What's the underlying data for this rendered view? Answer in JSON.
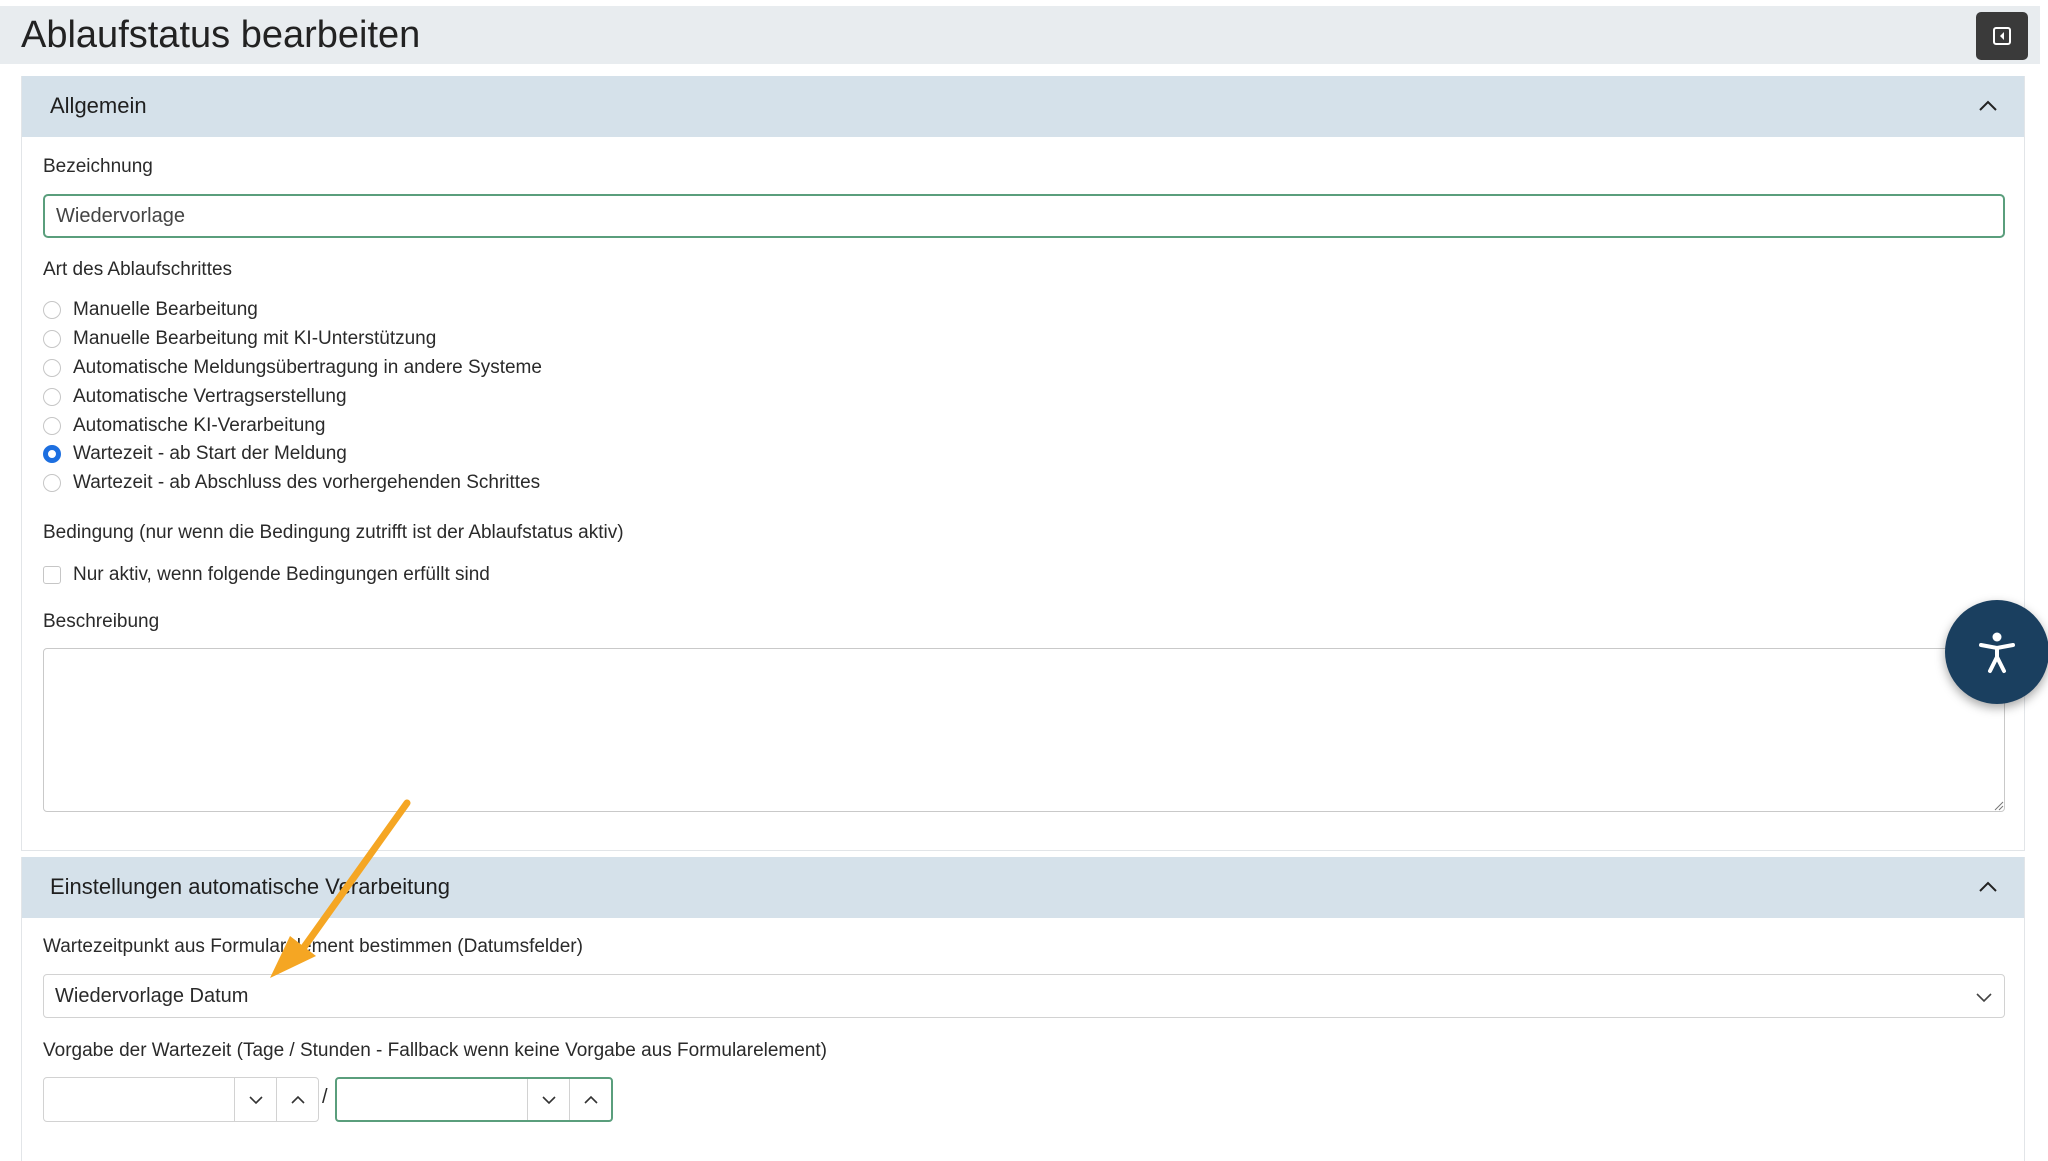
{
  "page": {
    "title": "Ablaufstatus bearbeiten"
  },
  "general": {
    "header": "Allgemein",
    "name_label": "Bezeichnung",
    "name_value": "Wiedervorlage",
    "type_label": "Art des Ablaufschrittes",
    "options": [
      {
        "label": "Manuelle Bearbeitung",
        "checked": false
      },
      {
        "label": "Manuelle Bearbeitung mit KI-Unterstützung",
        "checked": false
      },
      {
        "label": "Automatische Meldungsübertragung in andere Systeme",
        "checked": false
      },
      {
        "label": "Automatische Vertragserstellung",
        "checked": false
      },
      {
        "label": "Automatische KI-Verarbeitung",
        "checked": false
      },
      {
        "label": "Wartezeit - ab Start der Meldung",
        "checked": true
      },
      {
        "label": "Wartezeit - ab Abschluss des vorhergehenden Schrittes",
        "checked": false
      }
    ],
    "condition_label": "Bedingung (nur wenn die Bedingung zutrifft ist der Ablaufstatus aktiv)",
    "condition_checkbox_label": "Nur aktiv, wenn folgende Bedingungen erfüllt sind",
    "description_label": "Beschreibung",
    "description_value": ""
  },
  "auto": {
    "header": "Einstellungen automatische Verarbeitung",
    "wait_point_label": "Wartezeitpunkt aus Formularelement bestimmen (Datumsfelder)",
    "wait_point_value": "Wiedervorlage Datum",
    "default_wait_label": "Vorgabe der Wartezeit (Tage / Stunden - Fallback wenn keine Vorgabe aus Formularelement)",
    "days_value": "",
    "hours_value": "",
    "separator": "/"
  },
  "colors": {
    "section_header_bg": "#d5e1ea",
    "radio_checked": "#1d6fe0",
    "focus_border": "#5a9e7c",
    "a11y_button": "#1a3f5f",
    "annotation_arrow": "#f5a623"
  },
  "icons": {
    "collapse": "panel-collapse-icon",
    "section_toggle": "chevron-up-icon",
    "select": "chevron-down-icon",
    "accessibility": "accessibility-icon"
  }
}
